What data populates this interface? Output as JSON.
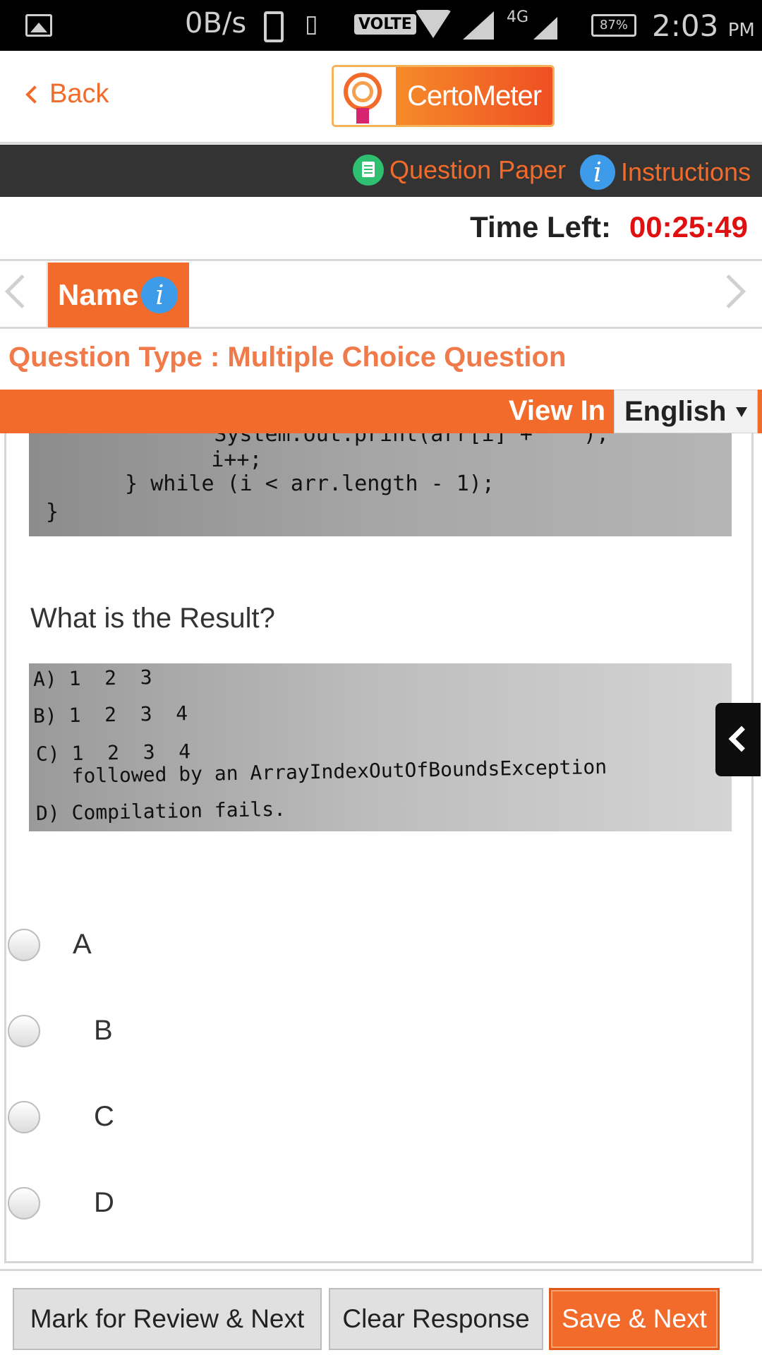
{
  "status_bar": {
    "net_speed": "0B/s",
    "volte": "VOLTE",
    "network_type": "4G",
    "battery": "87%",
    "time": "2:03",
    "ampm": "PM"
  },
  "header": {
    "back_label": "Back",
    "logo_text": "CertoMeter"
  },
  "toolbar": {
    "question_paper": "Question Paper",
    "instructions": "Instructions"
  },
  "timer": {
    "label": "Time Left:",
    "value": "00:25:49"
  },
  "section": {
    "tab_label": "Name",
    "info_glyph": "i"
  },
  "question": {
    "type_label": "Question Type : Multiple Choice Question",
    "view_in_label": "View In",
    "language": "English",
    "code_lines": [
      "    System.out.print(arr[i] + \" \");",
      "    i++;",
      "  } while (i < arr.length - 1);",
      "}"
    ],
    "prompt": "What is the Result?",
    "image_options": [
      "A) 1  2  3",
      "B) 1  2  3  4",
      "C) 1  2  3  4",
      "   followed by an ArrayIndexOutOfBoundsException",
      "D) Compilation fails."
    ],
    "answers": [
      "A",
      "B",
      "C",
      "D"
    ]
  },
  "footer": {
    "mark_review": "Mark for Review & Next",
    "clear": "Clear Response",
    "save_next": "Save & Next"
  },
  "colors": {
    "brand_orange": "#f26b2a",
    "timer_red": "#e01010",
    "toolbar_dark": "#333333",
    "info_blue": "#3d9be9",
    "doc_green": "#2fbf71"
  }
}
